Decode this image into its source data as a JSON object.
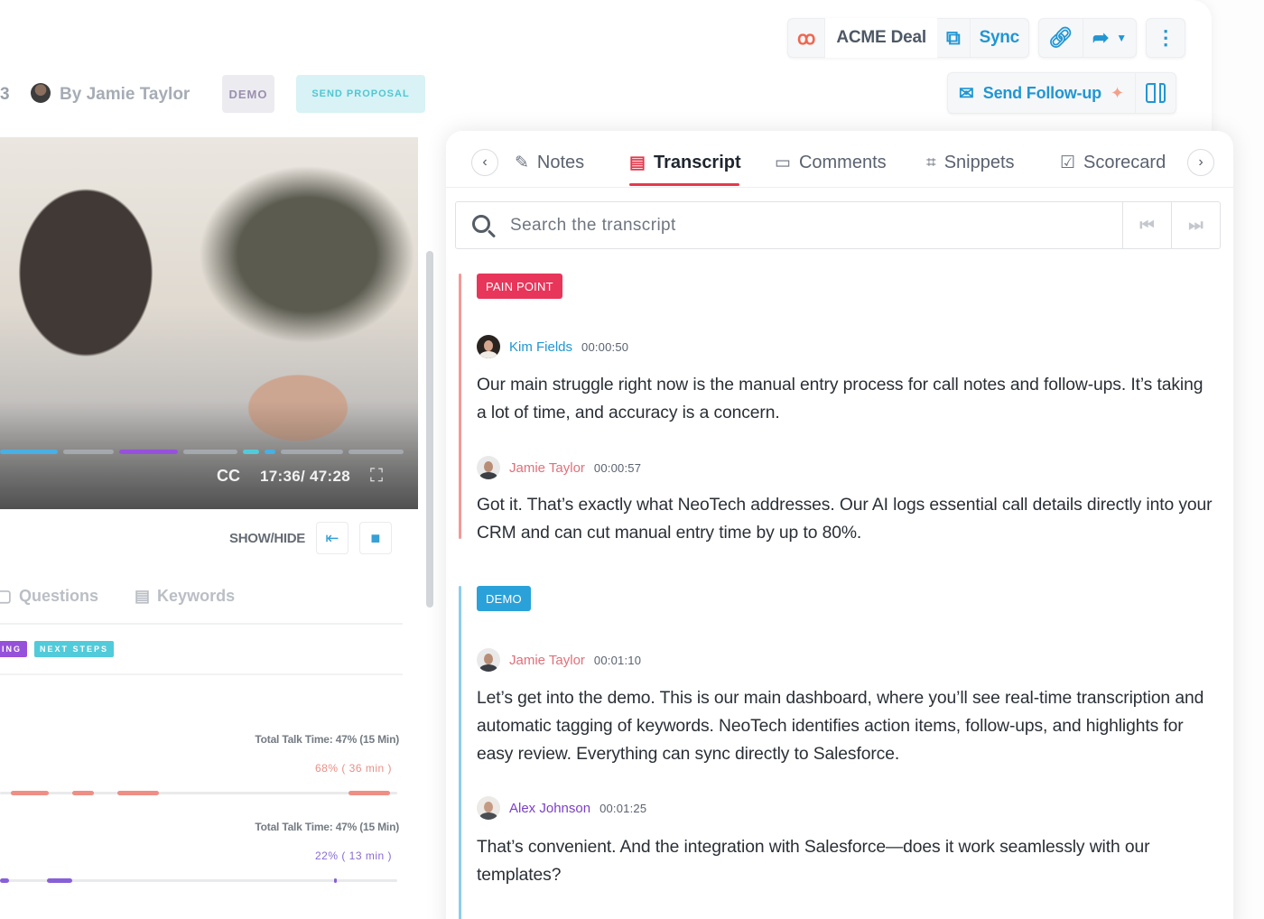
{
  "toolbar": {
    "crm_logo": "hubspot-icon",
    "crm_name": "ACME Deal",
    "sync_label": "Sync"
  },
  "meeting": {
    "number_fragment": "3",
    "by_label": "By Jamie Taylor",
    "tags": [
      "DEMO",
      "SEND PROPOSAL"
    ]
  },
  "follow_up": {
    "label": "Send Follow-up"
  },
  "video": {
    "cc_label": "CC",
    "time": "17:36/ 47:28",
    "progress_segments": [
      {
        "color": "#35a8e0",
        "fraction": 0.15
      },
      {
        "color": "#9aa0a6",
        "fraction": 0.13
      },
      {
        "color": "#8b3fd6",
        "fraction": 0.15
      },
      {
        "color": "#9aa0a6",
        "fraction": 0.14
      },
      {
        "color": "#3fc6d6",
        "fraction": 0.04
      },
      {
        "color": "#35a8e0",
        "fraction": 0.03
      },
      {
        "color": "#9aa0a6",
        "fraction": 0.16
      },
      {
        "color": "#9aa0a6",
        "fraction": 0.14
      }
    ]
  },
  "showhide": {
    "label": "SHOW/HIDE"
  },
  "left_tabs": [
    {
      "label": "Questions",
      "icon": "speech-bubble-icon"
    },
    {
      "label": "Keywords",
      "icon": "keywords-icon"
    }
  ],
  "left_tags": [
    {
      "label": "ING",
      "color": "#8b3fd6"
    },
    {
      "label": "NEXT STEPS",
      "color": "#3fc6d6"
    }
  ],
  "talk_time": [
    {
      "label": "Total Talk Time: 47% (15 Min)",
      "speaker_share": "68% ( 36 min )",
      "share_color": "#e5857a",
      "bar_color": "#ee8277"
    },
    {
      "label": "Total Talk Time: 47% (15 Min)",
      "speaker_share": "22% ( 13 min )",
      "share_color": "#7b5ad0",
      "bar_color": "#7b4fd3"
    }
  ],
  "panel": {
    "tabs": [
      {
        "label": "Notes",
        "icon": "notes-icon",
        "active": false
      },
      {
        "label": "Transcript",
        "icon": "transcript-icon",
        "active": true
      },
      {
        "label": "Comments",
        "icon": "comment-icon",
        "active": false
      },
      {
        "label": "Snippets",
        "icon": "crop-icon",
        "active": false
      },
      {
        "label": "Scorecard",
        "icon": "scorecard-icon",
        "active": false
      }
    ],
    "accent": "#e5394d"
  },
  "search": {
    "placeholder": "Search the transcript"
  },
  "sections": [
    {
      "tag": "PAIN POINT",
      "tag_color": "#e8355a",
      "bar_color": "#f29a97",
      "entries": [
        {
          "speaker": "Kim Fields",
          "speaker_color": "#2196d3",
          "time": "00:00:50",
          "text": "Our main struggle right now is the manual entry process for call notes and follow-ups. It’s taking a lot of time, and accuracy is a concern."
        },
        {
          "speaker": "Jamie Taylor",
          "speaker_color": "#e0707a",
          "time": "00:00:57",
          "text": "Got it. That’s exactly what NeoTech addresses. Our AI logs essential call details directly into your CRM and can cut manual entry time by up to 80%."
        }
      ]
    },
    {
      "tag": "DEMO",
      "tag_color": "#2ba1d9",
      "bar_color": "#8dcdea",
      "entries": [
        {
          "speaker": "Jamie Taylor",
          "speaker_color": "#e0707a",
          "time": "00:01:10",
          "text": "Let’s get into the demo. This is our main dashboard, where you’ll see real-time transcription and automatic tagging of keywords. NeoTech identifies action items, follow-ups, and highlights for easy review. Everything can sync directly to Salesforce."
        },
        {
          "speaker": "Alex Johnson",
          "speaker_color": "#7b3fc7",
          "time": "00:01:25",
          "text": "That’s convenient. And the integration with Salesforce—does it work seamlessly with our templates?"
        }
      ]
    }
  ]
}
